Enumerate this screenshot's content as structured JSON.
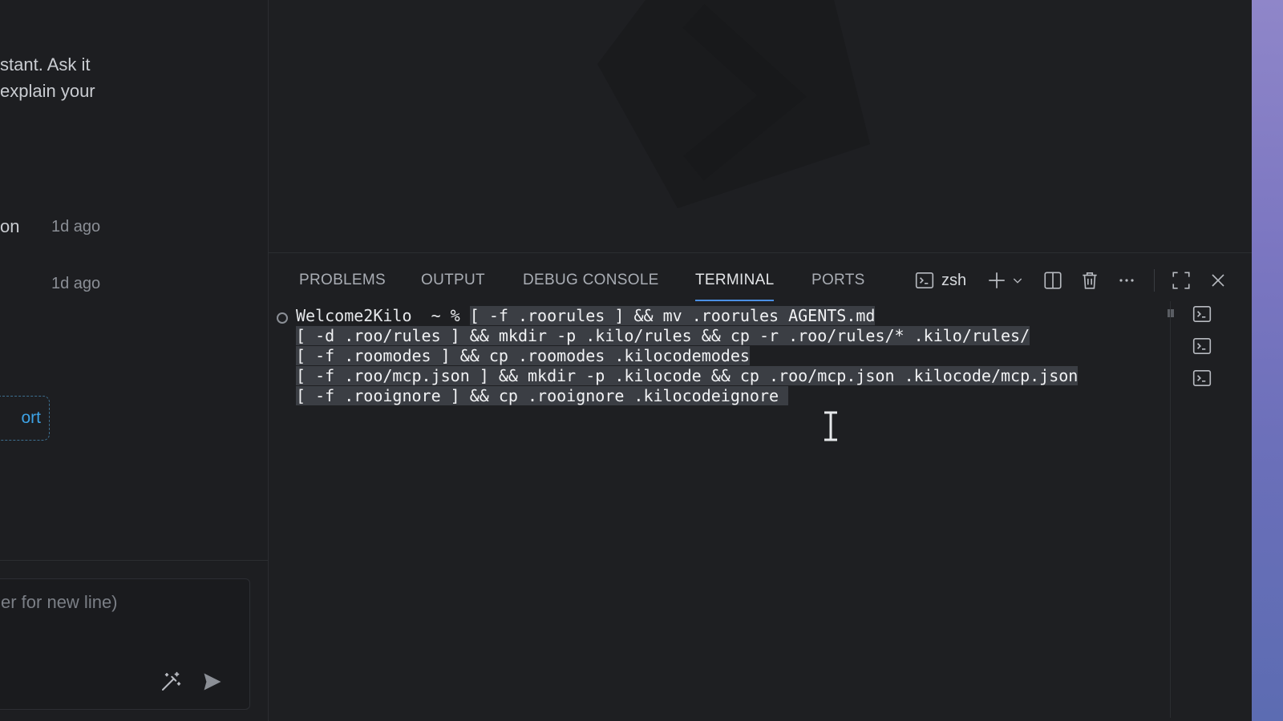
{
  "sidebar": {
    "intro_text": "stant. Ask it\nexplain your",
    "tasks": [
      {
        "title": "on",
        "time": "1d ago"
      },
      {
        "title": "",
        "time": "1d ago"
      }
    ],
    "support_label": "ort",
    "input_placeholder": "er for new line)"
  },
  "panel": {
    "tabs": [
      {
        "label": "PROBLEMS",
        "active": false
      },
      {
        "label": "OUTPUT",
        "active": false
      },
      {
        "label": "DEBUG CONSOLE",
        "active": false
      },
      {
        "label": "TERMINAL",
        "active": true
      },
      {
        "label": "PORTS",
        "active": false
      }
    ],
    "shell_name": "zsh"
  },
  "terminal": {
    "prompt": "Welcome2Kilo  ~ % ",
    "lines": [
      "[ -f .roorules ] && mv .roorules AGENTS.md",
      "[ -d .roo/rules ] && mkdir -p .kilo/rules && cp -r .roo/rules/* .kilo/rules/",
      "[ -f .roomodes ] && cp .roomodes .kilocodemodes",
      "[ -f .roo/mcp.json ] && mkdir -p .kilocode && cp .roo/mcp.json .kilocode/mcp.json",
      "[ -f .rooignore ] && cp .rooignore .kilocodeignore "
    ]
  },
  "icons": {
    "terminal": "terminal-icon",
    "add": "plus-icon",
    "dropdown": "chevron-down-icon",
    "split": "split-terminal-icon",
    "trash": "trash-icon",
    "more": "ellipsis-icon",
    "maximize": "maximize-icon",
    "close": "close-icon",
    "enhance": "magic-wand-icon",
    "send": "send-icon"
  },
  "colors": {
    "accent": "#4b8fe3",
    "link": "#3da3e6",
    "selection": "#3b3e44"
  }
}
